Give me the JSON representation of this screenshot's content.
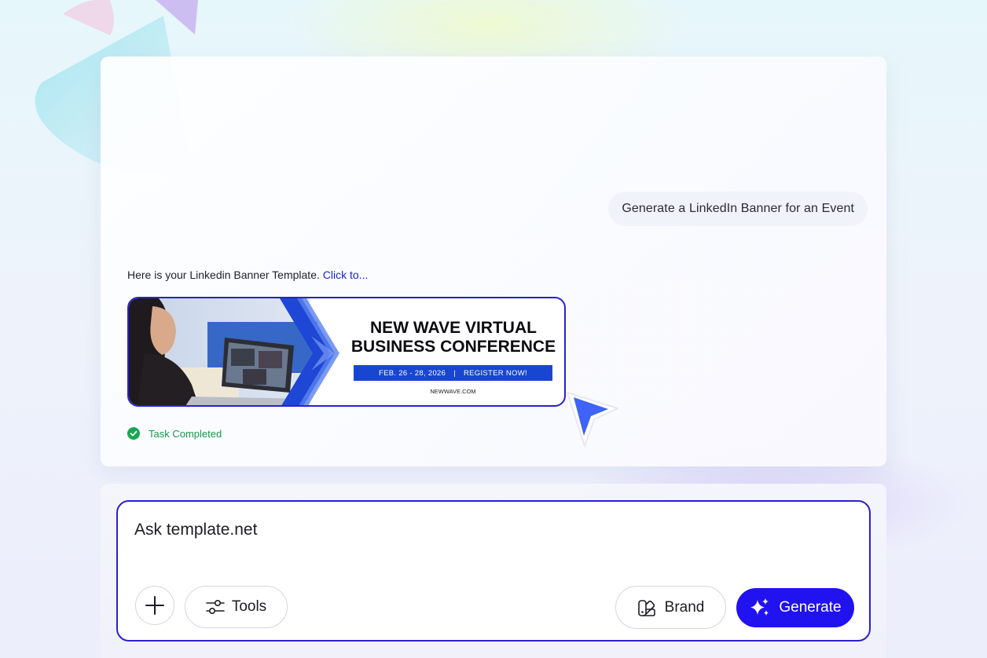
{
  "chat": {
    "user_message": "Generate a LinkedIn Banner for an Event",
    "reply_text": "Here is your Linkedin Banner Template.",
    "reply_link": "Click to...",
    "banner": {
      "title_line1": "NEW WAVE VIRTUAL",
      "title_line2": "BUSINESS CONFERENCE",
      "date": "FEB. 26 - 28, 2026",
      "separator": "|",
      "cta": "REGISTER NOW!",
      "url": "NEWWAVE.COM"
    },
    "status": "Task Completed"
  },
  "composer": {
    "placeholder": "Ask template.net",
    "tools_label": "Tools",
    "brand_label": "Brand",
    "generate_label": "Generate"
  },
  "colors": {
    "accent": "#2112f0",
    "border_accent": "#2b1fd0",
    "success": "#139a4b",
    "link": "#1b23d6",
    "banner_blue": "#1946d0"
  },
  "icons": [
    "check-circle-icon",
    "cursor-pointer-icon",
    "plus-icon",
    "sliders-icon",
    "brand-swatch-icon",
    "sparkles-icon"
  ]
}
